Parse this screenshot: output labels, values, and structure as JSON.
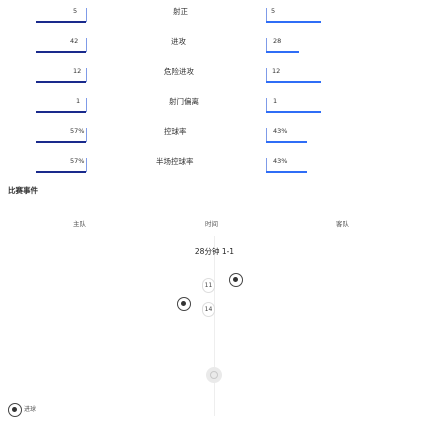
{
  "stats": [
    {
      "label": "射正",
      "left": "5",
      "right": "5"
    },
    {
      "label": "进攻",
      "left": "42",
      "right": "28"
    },
    {
      "label": "危险进攻",
      "left": "12",
      "right": "12"
    },
    {
      "label": "射门偏离",
      "left": "1",
      "right": "1"
    },
    {
      "label": "控球率",
      "left": "57%",
      "right": "43%"
    },
    {
      "label": "半场控球率",
      "left": "57%",
      "right": "43%"
    }
  ],
  "events": {
    "section_title": "比赛事件",
    "headers": {
      "home": "主队",
      "time": "时间",
      "away": "客队"
    },
    "score_line": "28分钟 1-1",
    "items": [
      {
        "minute": "11",
        "side": "away",
        "type": "goal"
      },
      {
        "minute": "14",
        "side": "home",
        "type": "goal"
      }
    ]
  },
  "legend": [
    {
      "icon": "goal-icon",
      "label": "进球"
    }
  ]
}
